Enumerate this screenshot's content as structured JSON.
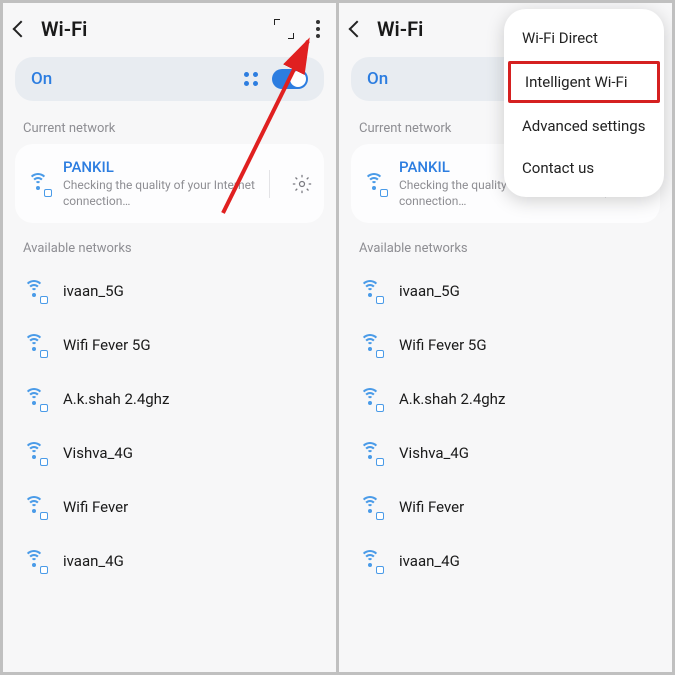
{
  "header": {
    "title": "Wi-Fi"
  },
  "toggle": {
    "label": "On"
  },
  "current": {
    "section_label": "Current network",
    "ssid": "PANKIL",
    "status": "Checking the quality of your Internet connection…"
  },
  "available": {
    "section_label": "Available networks",
    "networks": [
      {
        "name": "ivaan_5G"
      },
      {
        "name": "Wifi Fever 5G"
      },
      {
        "name": "A.k.shah 2.4ghz"
      },
      {
        "name": "Vishva_4G"
      },
      {
        "name": "Wifi Fever"
      },
      {
        "name": "ivaan_4G"
      }
    ]
  },
  "menu": {
    "items": [
      {
        "label": "Wi-Fi Direct",
        "highlighted": false
      },
      {
        "label": "Intelligent Wi-Fi",
        "highlighted": true
      },
      {
        "label": "Advanced settings",
        "highlighted": false
      },
      {
        "label": "Contact us",
        "highlighted": false
      }
    ]
  },
  "colors": {
    "accent": "#2c7de0",
    "highlight_border": "#d52020",
    "arrow": "#e02020"
  }
}
